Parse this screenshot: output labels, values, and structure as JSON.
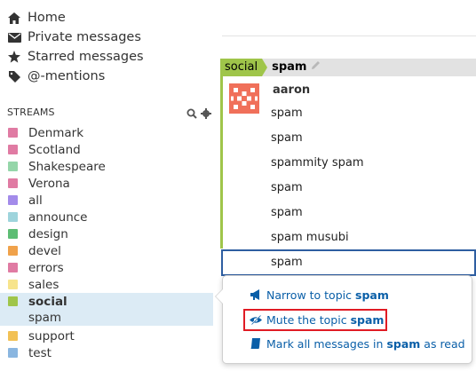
{
  "nav": {
    "home": "Home",
    "private": "Private messages",
    "starred": "Starred messages",
    "mentions": "@-mentions"
  },
  "streams_header": "STREAMS",
  "streams": [
    {
      "name": "Denmark",
      "color": "#e07ba3"
    },
    {
      "name": "Scotland",
      "color": "#e07ba3"
    },
    {
      "name": "Shakespeare",
      "color": "#95d6a9"
    },
    {
      "name": "Verona",
      "color": "#e07ba3"
    },
    {
      "name": "all",
      "color": "#a38bea"
    },
    {
      "name": "announce",
      "color": "#9ed4dc"
    },
    {
      "name": "design",
      "color": "#5dbd74"
    },
    {
      "name": "devel",
      "color": "#f0a24b"
    },
    {
      "name": "errors",
      "color": "#e07ba3"
    },
    {
      "name": "sales",
      "color": "#f7e48c"
    },
    {
      "name": "social",
      "color": "#9fc54a"
    },
    {
      "name": "support",
      "color": "#f2c155"
    },
    {
      "name": "test",
      "color": "#8ab6e0"
    }
  ],
  "active_topic": "spam",
  "recipient": {
    "stream": "social",
    "topic": "spam"
  },
  "sender": "aaron",
  "messages": [
    "spam",
    "spam",
    "spammity spam",
    "spam",
    "spam",
    "spam musubi",
    "spam"
  ],
  "popover": {
    "narrow_prefix": "Narrow to topic",
    "narrow_topic": "spam",
    "mute_prefix": "Mute the topic",
    "mute_topic": "spam",
    "mark_prefix": "Mark all messages in",
    "mark_topic": "spam",
    "mark_suffix": "as read"
  },
  "colors": {
    "link": "#0a5fa8",
    "highlight": "#e01b24",
    "selected_border": "#2e5ea1",
    "active_bg": "#dcebf5"
  }
}
